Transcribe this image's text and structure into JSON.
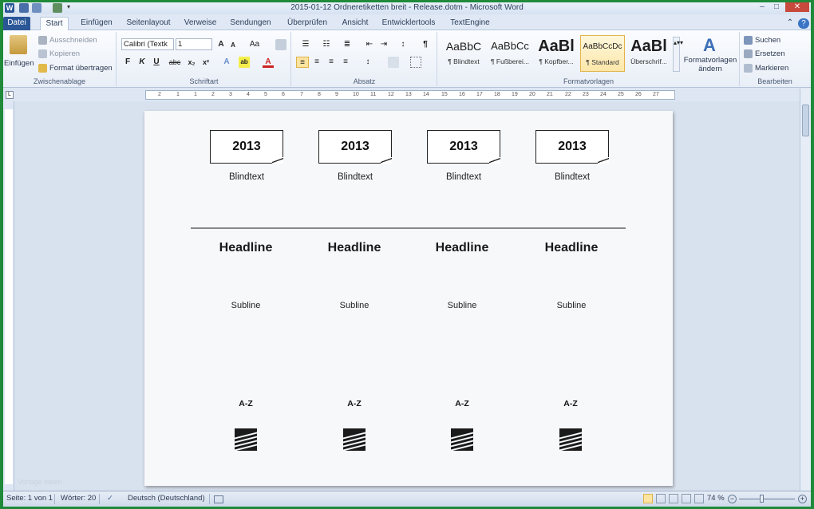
{
  "window": {
    "title": "2015-01-12 Ordneretiketten breit - Release.dotm - Microsoft Word",
    "min": "–",
    "max": "□",
    "close": "✕"
  },
  "tabs": [
    "Datei",
    "Start",
    "Einfügen",
    "Seitenlayout",
    "Verweise",
    "Sendungen",
    "Überprüfen",
    "Ansicht",
    "Entwicklertools",
    "TextEngine"
  ],
  "ribbon": {
    "clipboard": {
      "paste": "Einfügen",
      "cut": "Ausschneiden",
      "copy": "Kopieren",
      "format_painter": "Format übertragen",
      "label": "Zwischenablage"
    },
    "font": {
      "name": "Calibri (Textk",
      "size": "1",
      "label": "Schriftart",
      "bold": "F",
      "italic": "K",
      "underline": "U",
      "strike": "abc",
      "sub": "x₂",
      "sup": "x²",
      "grow": "A",
      "shrink": "A",
      "case": "Aa"
    },
    "paragraph": {
      "label": "Absatz",
      "pilcrow": "¶"
    },
    "styles": {
      "label": "Formatvorlagen",
      "items": [
        {
          "sample": "AaBbC",
          "name": "¶ Blindtext"
        },
        {
          "sample": "AaBbCc",
          "name": "¶ Fußberei..."
        },
        {
          "sample": "AaBl",
          "name": "¶ Kopfber..."
        },
        {
          "sample": "AaBbCcDc",
          "name": "¶ Standard"
        },
        {
          "sample": "AaBl",
          "name": "Überschrif..."
        }
      ],
      "change": "Formatvorlagen ändern"
    },
    "editing": {
      "label": "Bearbeiten",
      "find": "Suchen",
      "replace": "Ersetzen",
      "select": "Markieren"
    }
  },
  "document": {
    "labels": [
      {
        "year": "2013",
        "text": "Blindtext"
      },
      {
        "year": "2013",
        "text": "Blindtext"
      },
      {
        "year": "2013",
        "text": "Blindtext"
      },
      {
        "year": "2013",
        "text": "Blindtext"
      }
    ],
    "columns": [
      {
        "headline": "Headline",
        "subline": "Subline",
        "range": "A-Z"
      },
      {
        "headline": "Headline",
        "subline": "Subline",
        "range": "A-Z"
      },
      {
        "headline": "Headline",
        "subline": "Subline",
        "range": "A-Z"
      },
      {
        "headline": "Headline",
        "subline": "Subline",
        "range": "A-Z"
      }
    ],
    "watermark": "Vorlage Ideen"
  },
  "ruler": {
    "ticks": [
      "2",
      "1",
      "1",
      "2",
      "3",
      "4",
      "5",
      "6",
      "7",
      "8",
      "9",
      "10",
      "11",
      "12",
      "13",
      "14",
      "15",
      "16",
      "17",
      "18",
      "19",
      "20",
      "21",
      "22",
      "23",
      "24",
      "25",
      "26",
      "27"
    ]
  },
  "status": {
    "page": "Seite: 1 von 1",
    "words": "Wörter: 20",
    "language": "Deutsch (Deutschland)",
    "zoom": "74 %"
  },
  "colors": {
    "file_tab": "#2b5797",
    "selected_style": "#fde7a9",
    "page": "#f6f8fa"
  }
}
